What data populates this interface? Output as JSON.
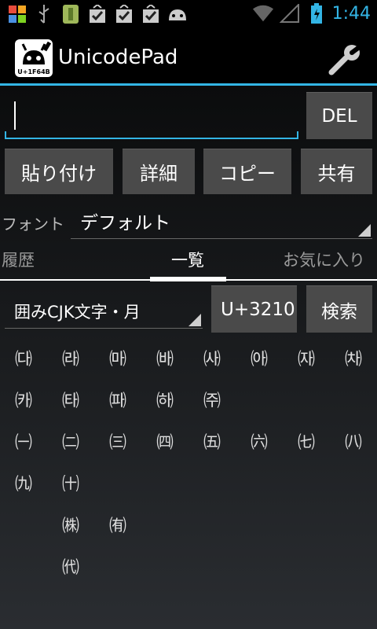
{
  "status_bar": {
    "time": "1:44",
    "icons": [
      "avast-icon",
      "usb-icon",
      "sd-card-icon",
      "download-done-icon",
      "download-done-icon",
      "download-done-icon",
      "android-icon",
      "wifi-icon",
      "signal-icon",
      "battery-icon"
    ],
    "accent": "#33b5e5"
  },
  "action_bar": {
    "title": "UnicodePad",
    "icon_code": "U+1F64B",
    "settings_icon": "wrench-icon"
  },
  "editor": {
    "input_value": "",
    "del_label": "DEL"
  },
  "buttons": {
    "paste": "貼り付け",
    "details": "詳細",
    "copy": "コピー",
    "share": "共有"
  },
  "font": {
    "label": "フォント",
    "selected": "デフォルト"
  },
  "tabs": {
    "history": "履歴",
    "list": "一覧",
    "favorites": "お気に入り",
    "active": "list"
  },
  "block": {
    "selected": "囲みCJK文字・月",
    "code_value": "U+3210",
    "search_label": "検索"
  },
  "characters": [
    [
      "㈐",
      "㈑",
      "㈒",
      "㈓",
      "㈔",
      "㈕",
      "㈖",
      "㈗"
    ],
    [
      "㈘",
      "㈙",
      "㈚",
      "㈛",
      "㈜",
      "",
      "",
      ""
    ],
    [
      "㈠",
      "㈡",
      "㈢",
      "㈣",
      "㈤",
      "㈥",
      "㈦",
      "㈧"
    ],
    [
      "㈨",
      "㈩",
      "",
      "",
      "",
      "",
      "",
      ""
    ],
    [
      "",
      "㈱",
      "㈲",
      "",
      "",
      "",
      "",
      ""
    ],
    [
      "",
      "㈹",
      "",
      "",
      "",
      "",
      "",
      ""
    ]
  ]
}
